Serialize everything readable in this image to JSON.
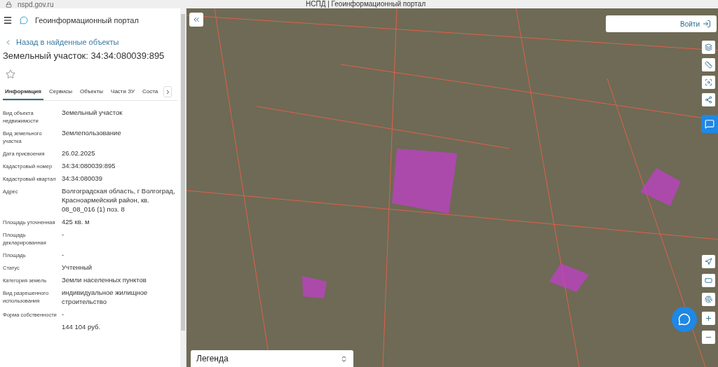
{
  "browser": {
    "address": "nspd.gov.ru",
    "title": "НСПД | Геоинформационный портал"
  },
  "header": {
    "title": "Геоинформационный портал"
  },
  "back_link": "Назад в найденные объекты",
  "object_title": "Земельный участок: 34:34:080039:895",
  "favorite": {
    "on": false
  },
  "tabs": [
    {
      "label": "Информация",
      "selected": true
    },
    {
      "label": "Сервисы",
      "selected": false
    },
    {
      "label": "Объекты",
      "selected": false
    },
    {
      "label": "Части ЗУ",
      "selected": false
    },
    {
      "label": "Соста",
      "selected": false
    }
  ],
  "properties": [
    {
      "label": "Вид объекта недвижимости",
      "value": "Земельный участок"
    },
    {
      "label": "Вид земельного участка",
      "value": "Землепользование"
    },
    {
      "label": "Дата присвоения",
      "value": "26.02.2025"
    },
    {
      "label": "Кадастровый номер",
      "value": "34:34:080039:895"
    },
    {
      "label": "Кадастровый квартал",
      "value": "34:34:080039"
    },
    {
      "label": "Адрес",
      "value": "Волгоградская область, г Волгоград, Красноармейский район, кв. 08_08_016 (1) поз. 8"
    },
    {
      "label": "Площадь уточненная",
      "value": "425 кв. м"
    },
    {
      "label": "Площадь декларированная",
      "value": "-"
    },
    {
      "label": "Площадь",
      "value": "-"
    },
    {
      "label": "Статус",
      "value": "Учтенный"
    },
    {
      "label": "Категория земель",
      "value": "Земли населенных пунктов"
    },
    {
      "label": "Вид разрешенного использования",
      "value": "индивидуальное жилищное строительство"
    },
    {
      "label": "Форма собственности",
      "value": "-"
    },
    {
      "value": "144 104 руб."
    }
  ],
  "map": {
    "login_button": "Войти",
    "legend": "Легенда"
  }
}
